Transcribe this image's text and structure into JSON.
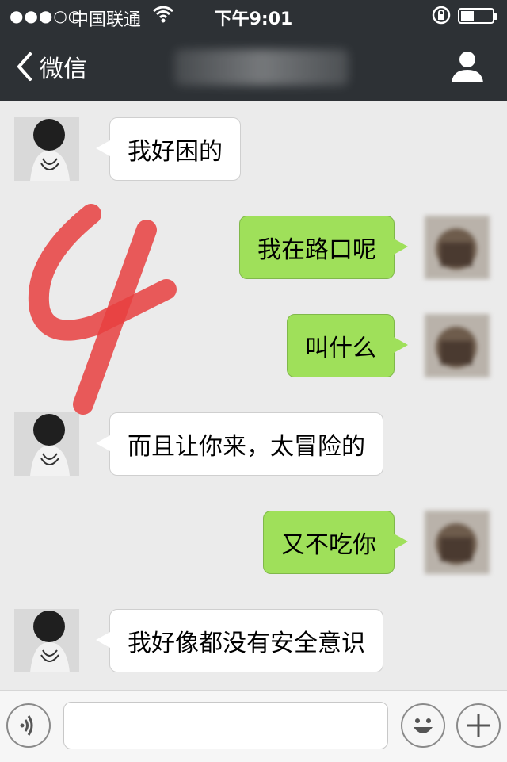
{
  "status_bar": {
    "signal": "●●●○○",
    "carrier": "中国联通",
    "time": "下午9:01"
  },
  "nav": {
    "back_label": "微信"
  },
  "messages": [
    {
      "side": "left",
      "text": "我好困的"
    },
    {
      "side": "right",
      "text": "我在路口呢"
    },
    {
      "side": "right",
      "text": "叫什么"
    },
    {
      "side": "left",
      "text": "而且让你来，太冒险的"
    },
    {
      "side": "right",
      "text": "又不吃你"
    },
    {
      "side": "left",
      "text": "我好像都没有安全意识"
    }
  ],
  "annotation": {
    "mark": "4",
    "color": "#e8403f"
  },
  "colors": {
    "topbar": "#2d3135",
    "chat_bg": "#ebebeb",
    "bubble_in": "#ffffff",
    "bubble_out": "#9fe05a"
  },
  "icons": [
    "back-chevron-icon",
    "person-icon",
    "voice-icon",
    "emoji-icon",
    "plus-icon",
    "wifi-icon",
    "lock-rotation-icon",
    "battery-icon"
  ]
}
